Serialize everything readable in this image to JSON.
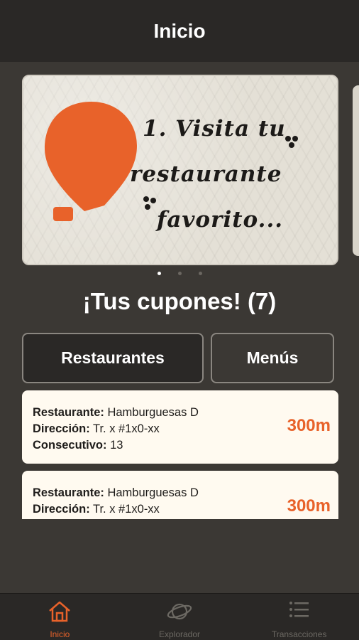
{
  "header": {
    "title": "Inicio"
  },
  "carousel": {
    "slides": [
      {
        "line1": "1. Visita tu",
        "line2": "restaurante",
        "line3": "favorito..."
      }
    ],
    "page_count": 3,
    "active_index": 0,
    "accent_color": "#e8622a"
  },
  "coupons": {
    "title": "¡Tus cupones! (7)"
  },
  "filter_tabs": {
    "restaurants_label": "Restaurantes",
    "menus_label": "Menús",
    "selected": "Restaurantes"
  },
  "coupon_list": [
    {
      "restaurant_label": "Restaurante:",
      "restaurant_value": "Hamburguesas D",
      "address_label": "Dirección:",
      "address_value": "Tr. x #1x0-xx",
      "consecutive_label": "Consecutivo:",
      "consecutive_value": "13",
      "distance": "300m"
    },
    {
      "restaurant_label": "Restaurante:",
      "restaurant_value": "Hamburguesas D",
      "address_label": "Dirección:",
      "address_value": "Tr. x #1x0-xx",
      "distance": "300m"
    }
  ],
  "tabbar": {
    "items": [
      {
        "label": "Inicio",
        "icon": "home-icon",
        "active": true
      },
      {
        "label": "Explorador",
        "icon": "planet-icon",
        "active": false
      },
      {
        "label": "Transacciones",
        "icon": "list-icon",
        "active": false
      }
    ]
  }
}
